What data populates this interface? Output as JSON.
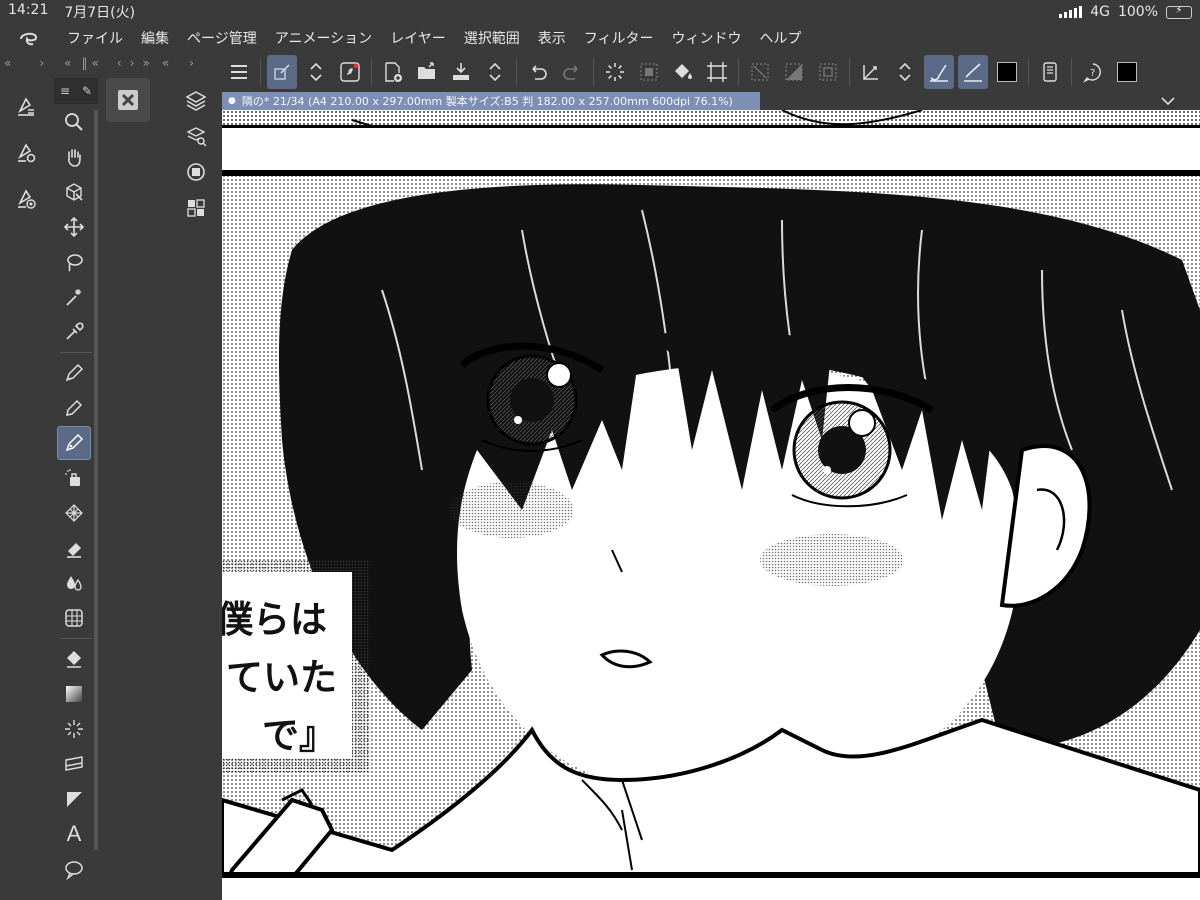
{
  "status_bar": {
    "time": "14:21",
    "date": "7月7日(火)",
    "network": "4G",
    "battery": "100%"
  },
  "menu": {
    "items": [
      "ファイル",
      "編集",
      "ページ管理",
      "アニメーション",
      "レイヤー",
      "選択範囲",
      "表示",
      "フィルター",
      "ウィンドウ",
      "ヘルプ"
    ]
  },
  "document": {
    "tab_title": "隣の* 21/34 (A4 210.00 x 297.00mm 製本サイズ:B5 判 182.00 x 257.00mm 600dpi 76.1%)"
  },
  "canvas_caption": {
    "lines": [
      "僕らは",
      "ていた",
      "で』"
    ]
  },
  "colors": {
    "accent": "#5b6a86",
    "tab": "#7d8fb5",
    "panel": "#3a3a3a",
    "main_color": "#000000",
    "battery_fill": "#37c93c"
  },
  "icons": {
    "left_column": [
      "layer-property-icon",
      "layer-settings-icon",
      "layer-target-icon"
    ],
    "tools": [
      "zoom-icon",
      "hand-icon",
      "object-icon",
      "move-icon",
      "lasso-icon",
      "magic-wand-icon",
      "eyedropper-icon",
      "pen-icon",
      "pencil-icon",
      "brush-icon",
      "airbrush-icon",
      "decoration-icon",
      "eraser-icon",
      "blend-icon",
      "figure-icon",
      "fill-icon",
      "gradient-icon",
      "frame-icon",
      "ruler-icon",
      "balloon-icon",
      "text-icon",
      "speech-balloon-icon"
    ],
    "sub_tool": [
      "sub-tool-icon"
    ],
    "right_column": [
      "layers-panel-icon",
      "layer-search-icon",
      "navigator-icon",
      "color-palette-icon"
    ],
    "toolbar": [
      "menu-icon",
      "layer-edit-icon",
      "stepper-icon",
      "spiral-icon",
      "new-page-icon",
      "open-icon",
      "save-icon",
      "stepper-icon",
      "undo-icon",
      "redo-icon",
      "loading-icon",
      "clear-icon",
      "fill-tone-icon",
      "crop-icon",
      "deselect-icon",
      "invert-icon",
      "selection-box-icon",
      "ruler-snap-icon",
      "stepper-icon",
      "snap-brush-icon",
      "snap-line-icon",
      "color-swatch-icon",
      "device-icon",
      "help-icon",
      "color-swatch-icon"
    ]
  }
}
